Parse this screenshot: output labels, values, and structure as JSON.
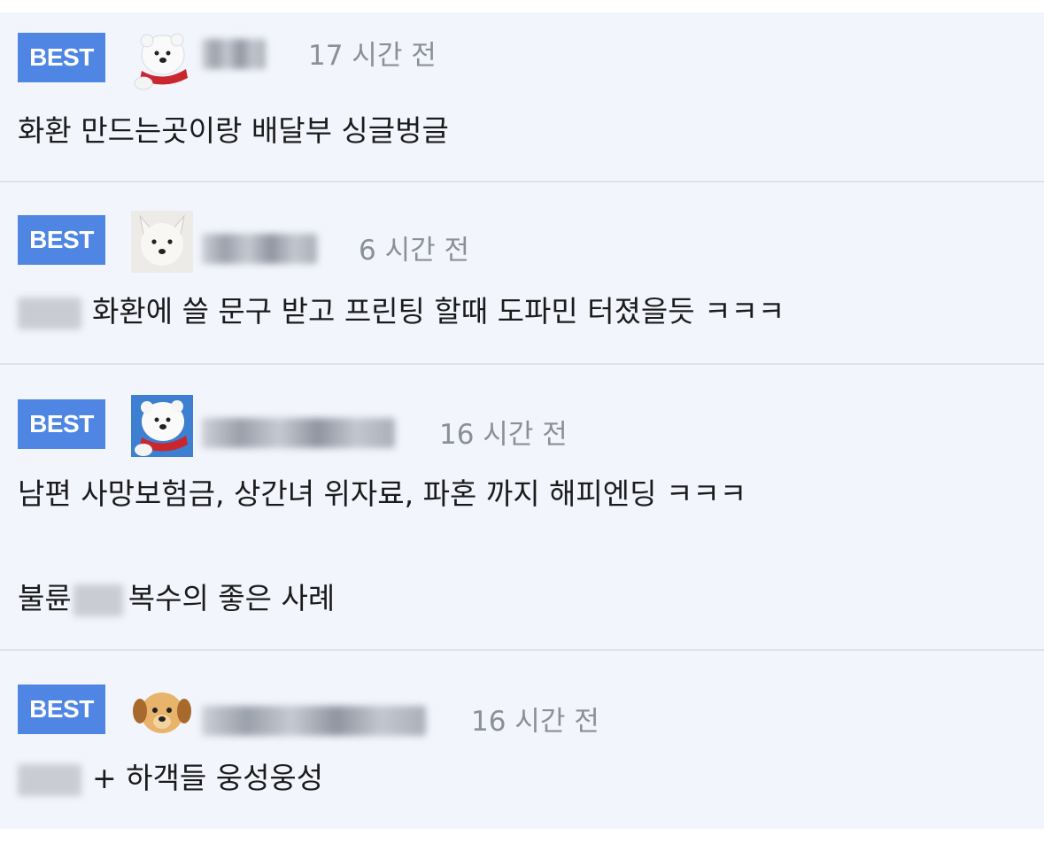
{
  "comments": [
    {
      "badge": "BEST",
      "avatar": "polar-bear-scarf-icon",
      "time": "17 시간 전",
      "lines": [
        "화환 만드는곳이랑 배달부 싱글벙글"
      ]
    },
    {
      "badge": "BEST",
      "avatar": "white-dog-icon",
      "time": "6 시간 전",
      "lines": [
        "화환에 쓸 문구 받고 프린팅 할때 도파민 터졌을듯 ㅋㅋㅋ"
      ]
    },
    {
      "badge": "BEST",
      "avatar": "polar-bear-blue-icon",
      "time": "16 시간 전",
      "lines": [
        "남편 사망보험금, 상간녀 위자료, 파혼 까지 해피엔딩 ㅋㅋㅋ",
        "불륜",
        "복수의 좋은 사례"
      ]
    },
    {
      "badge": "BEST",
      "avatar": "puppy-face-icon",
      "time": "16 시간 전",
      "lines": [
        "+ 하객들 웅성웅성"
      ]
    }
  ],
  "colors": {
    "badge": "#4f86e3",
    "panel": "#f3f5fc",
    "divider": "#dfe2ea",
    "time": "#8b8f97",
    "text": "#1b1b1b"
  }
}
